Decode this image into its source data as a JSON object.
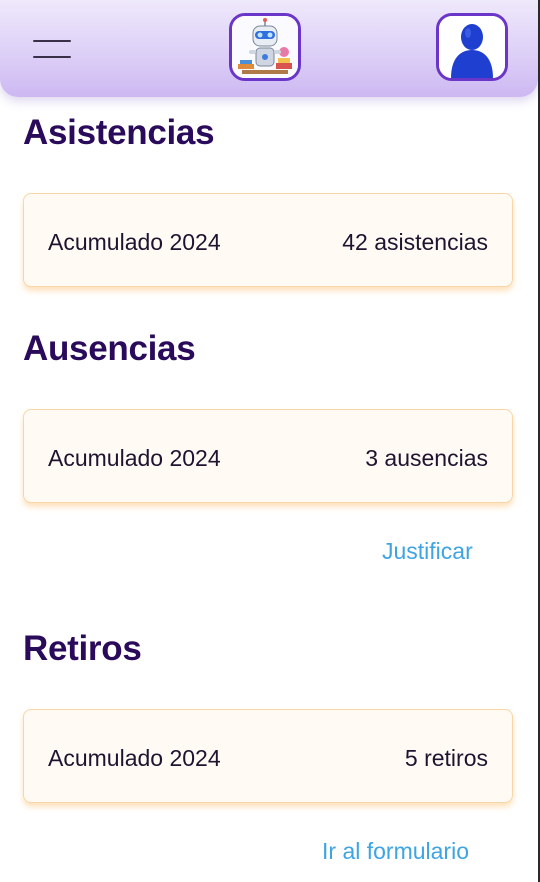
{
  "header": {
    "menu_icon": "hamburger-menu-icon",
    "logo_icon": "robot-mascot-logo",
    "avatar_icon": "user-avatar-icon"
  },
  "sections": {
    "attendance": {
      "title": "Asistencias",
      "label": "Acumulado 2024",
      "value": "42 asistencias"
    },
    "absences": {
      "title": "Ausencias",
      "label": "Acumulado 2024",
      "value": "3 ausencias",
      "link": "Justificar"
    },
    "withdrawals": {
      "title": "Retiros",
      "label": "Acumulado 2024",
      "value": "5 retiros",
      "link": "Ir al formulario"
    }
  },
  "colors": {
    "title": "#2a0a5a",
    "link": "#3ea4e2",
    "card_border": "#f8d6a8",
    "header_accent": "#6a36c9"
  }
}
